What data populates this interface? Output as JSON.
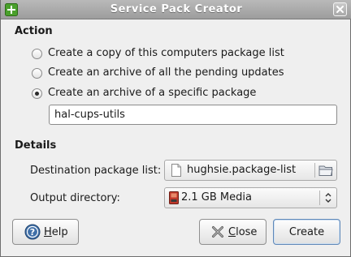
{
  "window": {
    "title": "Service Pack Creator",
    "colors": {
      "titlebar": "#a9a9a9",
      "background": "#efefef",
      "default_button_border": "#5f88b8"
    }
  },
  "action": {
    "heading": "Action",
    "options": [
      {
        "label": "Create a copy of this computers package list",
        "selected": false
      },
      {
        "label": "Create an archive of all the pending updates",
        "selected": false
      },
      {
        "label": "Create an archive of a specific package",
        "selected": true
      }
    ],
    "package_value": "hal-cups-utils"
  },
  "details": {
    "heading": "Details",
    "destination_label": "Destination package list:",
    "destination_value": "hughsie.package-list",
    "output_label": "Output directory:",
    "output_value": "2.1 GB Media"
  },
  "buttons": {
    "help": {
      "prefix": "",
      "mnemonic": "H",
      "rest": "elp",
      "icon": "help-icon"
    },
    "close": {
      "prefix": "",
      "mnemonic": "C",
      "rest": "lose",
      "icon": "close-x-icon"
    },
    "create": "Create"
  }
}
